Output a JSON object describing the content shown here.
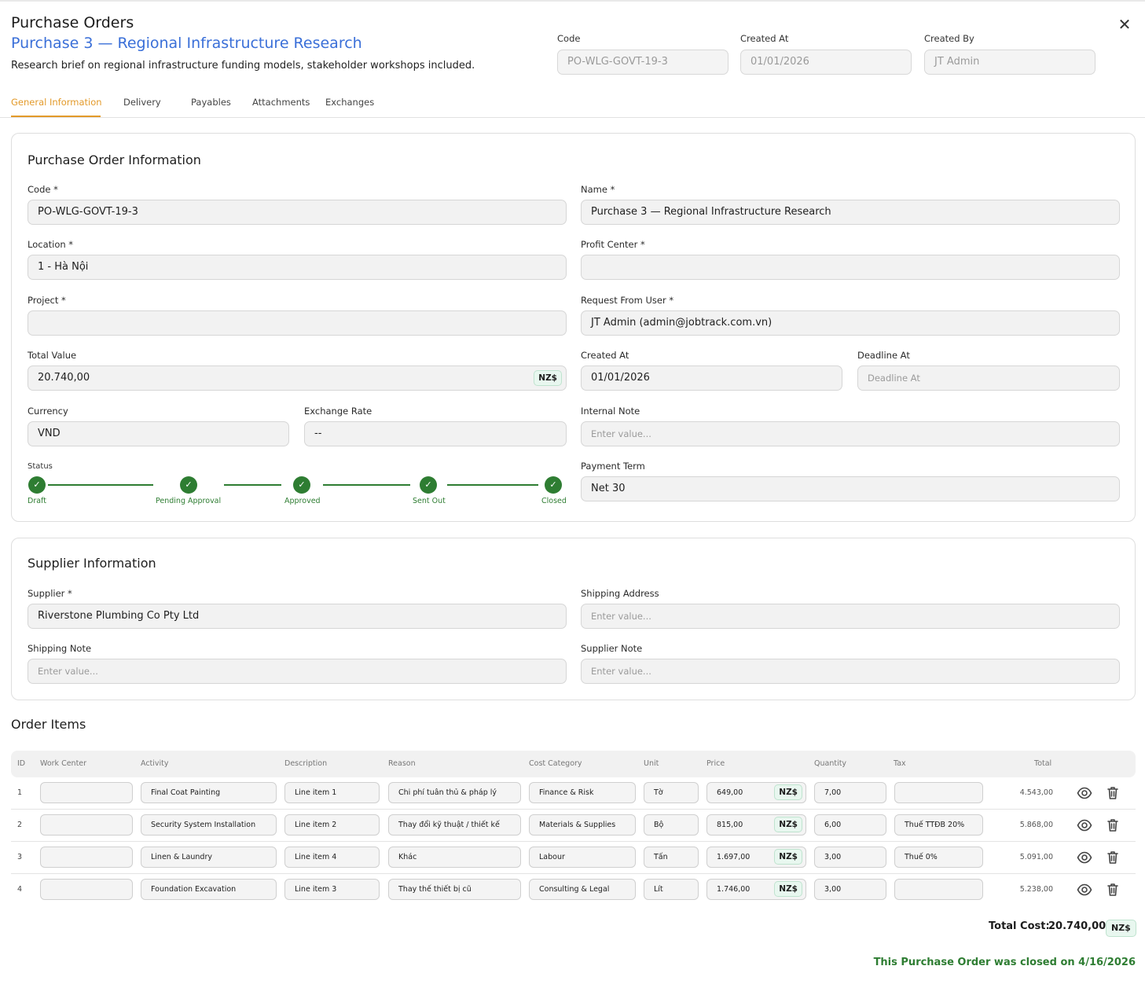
{
  "header": {
    "title": "Purchase Orders",
    "subtitle": "Purchase 3 — Regional Infrastructure Research",
    "description": "Research brief on regional infrastructure funding models, stakeholder workshops included.",
    "close_icon": "close-icon",
    "fields": {
      "code": {
        "label": "Code",
        "value": "PO-WLG-GOVT-19-3"
      },
      "created_at": {
        "label": "Created At",
        "value": "01/01/2026"
      },
      "created_by": {
        "label": "Created By",
        "value": "JT Admin"
      }
    }
  },
  "tabs": [
    {
      "label": "General Information",
      "active": true
    },
    {
      "label": "Delivery"
    },
    {
      "label": "Payables"
    },
    {
      "label": "Attachments"
    },
    {
      "label": "Exchanges"
    }
  ],
  "po_info": {
    "title": "Purchase Order Information",
    "code": {
      "label": "Code *",
      "value": "PO-WLG-GOVT-19-3"
    },
    "name": {
      "label": "Name *",
      "value": "Purchase 3 — Regional Infrastructure Research"
    },
    "location": {
      "label": "Location *",
      "value": "1 - Hà Nội"
    },
    "profit_center": {
      "label": "Profit Center *",
      "value": ""
    },
    "project": {
      "label": "Project *",
      "value": ""
    },
    "request_from_user": {
      "label": "Request From User *",
      "value": "JT Admin (admin@jobtrack.com.vn)"
    },
    "total_value": {
      "label": "Total Value",
      "value": "20.740,00",
      "currency": "NZ$"
    },
    "created_at": {
      "label": "Created At",
      "value": "01/01/2026"
    },
    "deadline_at": {
      "label": "Deadline At",
      "placeholder": "Deadline At"
    },
    "currency": {
      "label": "Currency",
      "value": "VND"
    },
    "exchange_rate": {
      "label": "Exchange Rate",
      "value": "--"
    },
    "internal_note": {
      "label": "Internal Note",
      "placeholder": "Enter value..."
    },
    "payment_term": {
      "label": "Payment Term",
      "value": "Net 30"
    },
    "status": {
      "label": "Status",
      "steps": [
        "Draft",
        "Pending Approval",
        "Approved",
        "Sent Out",
        "Closed"
      ],
      "check_icon": "check-icon",
      "color": "#2e7d32"
    }
  },
  "supplier_info": {
    "title": "Supplier Information",
    "supplier": {
      "label": "Supplier *",
      "value": "Riverstone Plumbing Co Pty Ltd"
    },
    "shipping_address": {
      "label": "Shipping Address",
      "placeholder": "Enter value..."
    },
    "shipping_note": {
      "label": "Shipping Note",
      "placeholder": "Enter value..."
    },
    "supplier_note": {
      "label": "Supplier Note",
      "placeholder": "Enter value..."
    }
  },
  "order_items": {
    "title": "Order Items",
    "columns": [
      "ID",
      "Work Center",
      "Activity",
      "Description",
      "Reason",
      "Cost Category",
      "Unit",
      "Price",
      "Quantity",
      "Tax",
      "Total"
    ],
    "rows": [
      {
        "id": "1",
        "work_center": "",
        "activity": "Final Coat Painting",
        "description": "Line item 1",
        "reason": "Chi phí tuân thủ & pháp lý",
        "cost_category": "Finance & Risk",
        "unit": "Tờ",
        "price": "649,00",
        "currency": "NZ$",
        "quantity": "7,00",
        "tax": "",
        "total": "4.543,00"
      },
      {
        "id": "2",
        "work_center": "",
        "activity": "Security System Installation",
        "description": "Line item 2",
        "reason": "Thay đổi kỹ thuật / thiết kế",
        "cost_category": "Materials & Supplies",
        "unit": "Bộ",
        "price": "815,00",
        "currency": "NZ$",
        "quantity": "6,00",
        "tax": "Thuế TTĐB 20%",
        "total": "5.868,00"
      },
      {
        "id": "3",
        "work_center": "",
        "activity": "Linen & Laundry",
        "description": "Line item 4",
        "reason": "Khác",
        "cost_category": "Labour",
        "unit": "Tấn",
        "price": "1.697,00",
        "currency": "NZ$",
        "quantity": "3,00",
        "tax": "Thuế 0%",
        "total": "5.091,00"
      },
      {
        "id": "4",
        "work_center": "",
        "activity": "Foundation Excavation",
        "description": "Line item 3",
        "reason": "Thay thế thiết bị cũ",
        "cost_category": "Consulting & Legal",
        "unit": "Lít",
        "price": "1.746,00",
        "currency": "NZ$",
        "quantity": "3,00",
        "tax": "",
        "total": "5.238,00"
      }
    ],
    "row_icons": [
      "eye-icon",
      "trash-icon"
    ],
    "total_cost_label": "Total Cost:",
    "total_cost_value": "20.740,00",
    "total_cost_currency": "NZ$"
  },
  "closed_note": "This Purchase Order was closed on 4/16/2026",
  "colors": {
    "accent": "#e39a2a",
    "link_blue": "#3a6fd8",
    "success": "#2e7d32",
    "badge_bg": "#e8f7ef"
  }
}
